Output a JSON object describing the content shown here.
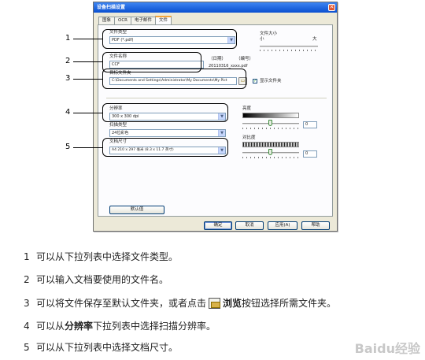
{
  "dialog": {
    "title": "设备扫描设置",
    "tabs": [
      "图象",
      "OCR",
      "电子邮件",
      "文件"
    ],
    "active_tab": "文件",
    "file_type": {
      "label": "文件类型",
      "value": "PDF (*.pdf)"
    },
    "file_size": {
      "label": "文件大小",
      "small": "小",
      "large": "大"
    },
    "file_name": {
      "label": "文件名称",
      "value": "CCF",
      "date_label": "（日期）",
      "number_label": "（编号）",
      "example": "20110316_xxxx.pdf"
    },
    "dest_folder": {
      "label": "目标文件夹",
      "value": "C:\\Documents and Settings\\Administrator\\My Documents\\My Pict",
      "show_folder_label": "显示文件夹"
    },
    "resolution": {
      "label": "分辨率",
      "value": "300 x 300 dpi"
    },
    "scan_type": {
      "label": "扫描类型",
      "value": "24位彩色"
    },
    "doc_size": {
      "label": "文档尺寸",
      "value": "A4 210 x 297 毫米 (8.3 x 11.7 英寸)"
    },
    "brightness": {
      "label": "亮度",
      "value": "0"
    },
    "contrast": {
      "label": "对比度",
      "value": "0"
    },
    "buttons": {
      "default": "默认值",
      "ok": "确定",
      "cancel": "取消",
      "apply": "应用(A)",
      "help": "帮助"
    }
  },
  "callouts": [
    "1",
    "2",
    "3",
    "4",
    "5"
  ],
  "instructions": [
    {
      "num": "1",
      "text": "可以从下拉列表中选择文件类型。"
    },
    {
      "num": "2",
      "text": "可以输入文档要使用的文件名。"
    },
    {
      "num": "3",
      "pre": "可以将文件保存至默认文件夹，或者点击",
      "bold": "浏览",
      "post": "按钮选择所需文件夹。"
    },
    {
      "num": "4",
      "pre": "可以从",
      "bold": "分辨率",
      "post": "下拉列表中选择扫描分辨率。"
    },
    {
      "num": "5",
      "text": "可以从下拉列表中选择文档尺寸。"
    }
  ],
  "watermark": "Baidu经验"
}
